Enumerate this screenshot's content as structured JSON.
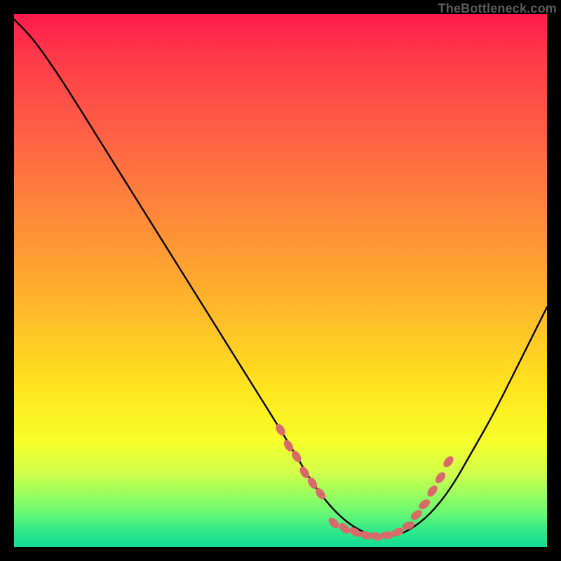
{
  "watermark": "TheBottleneck.com",
  "colors": {
    "curve": "#000000",
    "dots": "#d86a6a",
    "frame": "#000000"
  },
  "chart_data": {
    "type": "line",
    "title": "",
    "xlabel": "",
    "ylabel": "",
    "xlim": [
      0,
      100
    ],
    "ylim": [
      0,
      100
    ],
    "grid": false,
    "series": [
      {
        "name": "bottleneck-curve",
        "x": [
          0,
          3,
          6,
          10,
          15,
          20,
          25,
          30,
          35,
          40,
          45,
          50,
          53,
          56,
          59,
          62,
          65,
          68,
          71,
          74,
          78,
          82,
          86,
          90,
          95,
          100
        ],
        "values": [
          99,
          96,
          92,
          86,
          78,
          70,
          62,
          54,
          46,
          38,
          30,
          22,
          17,
          12,
          8,
          5,
          3,
          2,
          2,
          3,
          6,
          11,
          18,
          25,
          35,
          45
        ]
      }
    ],
    "dot_clusters": [
      {
        "name": "left-descent-dots",
        "points": [
          {
            "x": 50,
            "y": 22
          },
          {
            "x": 51.5,
            "y": 19
          },
          {
            "x": 53,
            "y": 17
          },
          {
            "x": 54.5,
            "y": 14
          },
          {
            "x": 56,
            "y": 12
          },
          {
            "x": 57.5,
            "y": 10
          }
        ]
      },
      {
        "name": "valley-dots",
        "points": [
          {
            "x": 60,
            "y": 4.5
          },
          {
            "x": 62,
            "y": 3.5
          },
          {
            "x": 64,
            "y": 2.8
          },
          {
            "x": 66,
            "y": 2.2
          },
          {
            "x": 68,
            "y": 2.0
          },
          {
            "x": 70,
            "y": 2.2
          },
          {
            "x": 72,
            "y": 2.8
          }
        ]
      },
      {
        "name": "right-ascent-dots",
        "points": [
          {
            "x": 74,
            "y": 4
          },
          {
            "x": 75.5,
            "y": 6
          },
          {
            "x": 77,
            "y": 8
          },
          {
            "x": 78.5,
            "y": 10.5
          },
          {
            "x": 80,
            "y": 13
          },
          {
            "x": 81.5,
            "y": 16
          }
        ]
      }
    ]
  }
}
